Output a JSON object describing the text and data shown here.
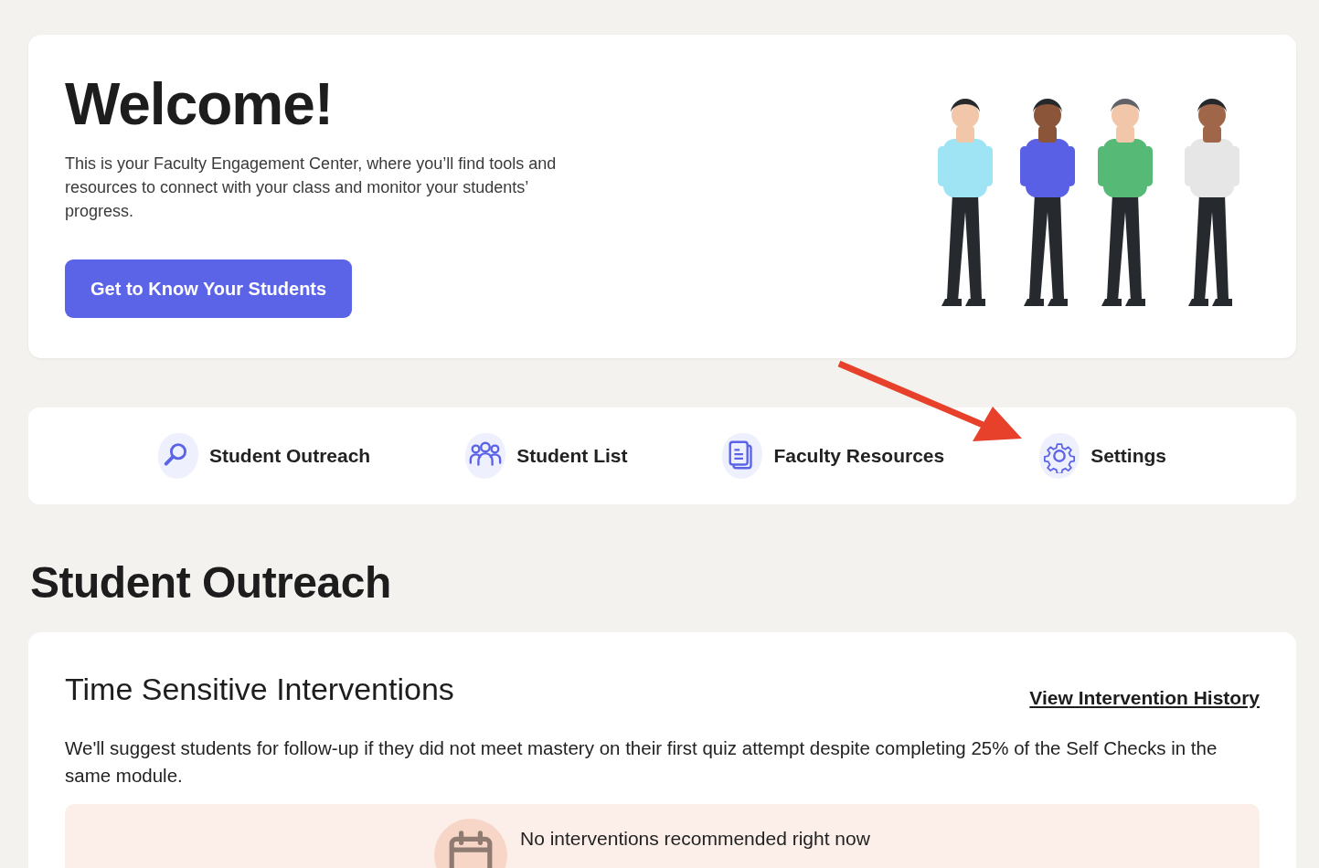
{
  "hero": {
    "title": "Welcome!",
    "text": "This is your Faculty Engagement Center, where you’ll find tools and resources to connect with your class and monitor your students’ progress.",
    "button": "Get to Know Your Students"
  },
  "nav": [
    {
      "kind": "search",
      "label": "Student Outreach"
    },
    {
      "kind": "people",
      "label": "Student List"
    },
    {
      "kind": "document",
      "label": "Faculty Resources"
    },
    {
      "kind": "gear",
      "label": "Settings"
    }
  ],
  "section": {
    "heading": "Student Outreach",
    "card": {
      "title": "Time Sensitive Interventions",
      "link": "View Intervention History",
      "text": "We'll suggest students for follow-up if they did not meet mastery on their first quiz attempt despite completing 25% of the Self Checks in the same module.",
      "empty_message": "No interventions recommended right now"
    }
  }
}
